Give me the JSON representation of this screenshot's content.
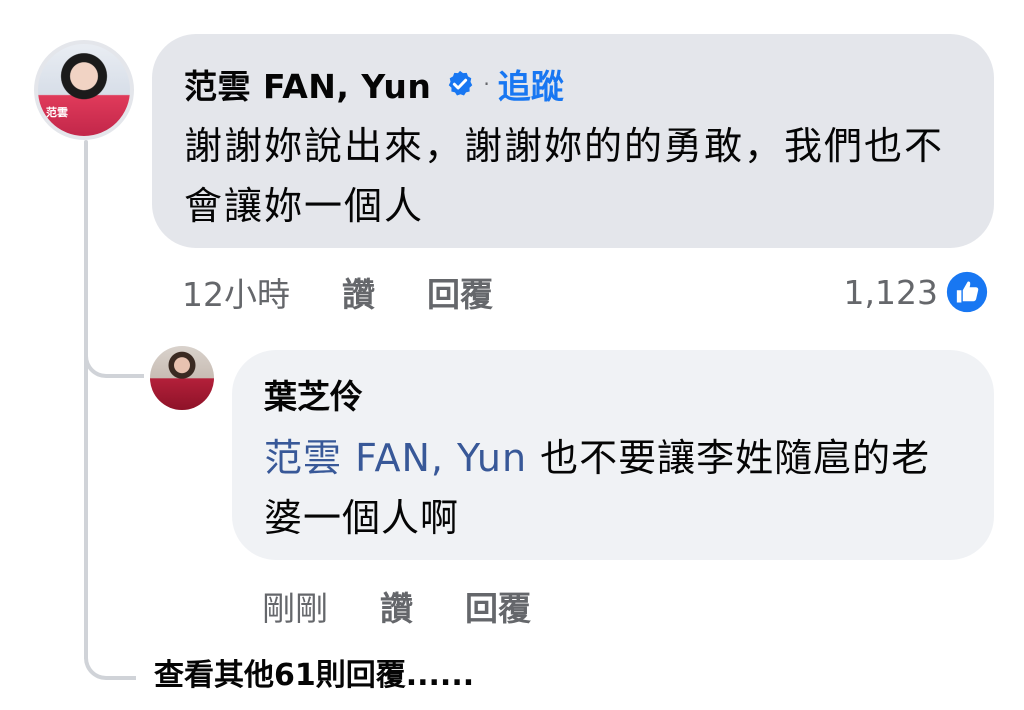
{
  "main_comment": {
    "author": "范雲  FAN, Yun",
    "separator": "·",
    "follow_label": "追蹤",
    "text": "謝謝妳說出來，謝謝妳的的勇敢，我們也不會讓妳一個人",
    "avatar_tag": "范雲",
    "time": "12小時",
    "like_label": "讚",
    "reply_label": "回覆",
    "reaction_count": "1,123"
  },
  "reply": {
    "author": "葉芝伶",
    "mention": "范雲  FAN, Yun",
    "text": " 也不要讓李姓隨扈的老婆一個人啊",
    "time": "剛剛",
    "like_label": "讚",
    "reply_label": "回覆"
  },
  "view_more_label": "查看其他61則回覆......",
  "colors": {
    "bubble_main": "#e4e6eb",
    "bubble_reply": "#f0f2f5",
    "link_blue": "#1877f2",
    "mention_blue": "#385898",
    "meta_gray": "#65676b"
  },
  "icons": {
    "verified": "verified-badge-icon",
    "like": "like-thumb-icon"
  }
}
